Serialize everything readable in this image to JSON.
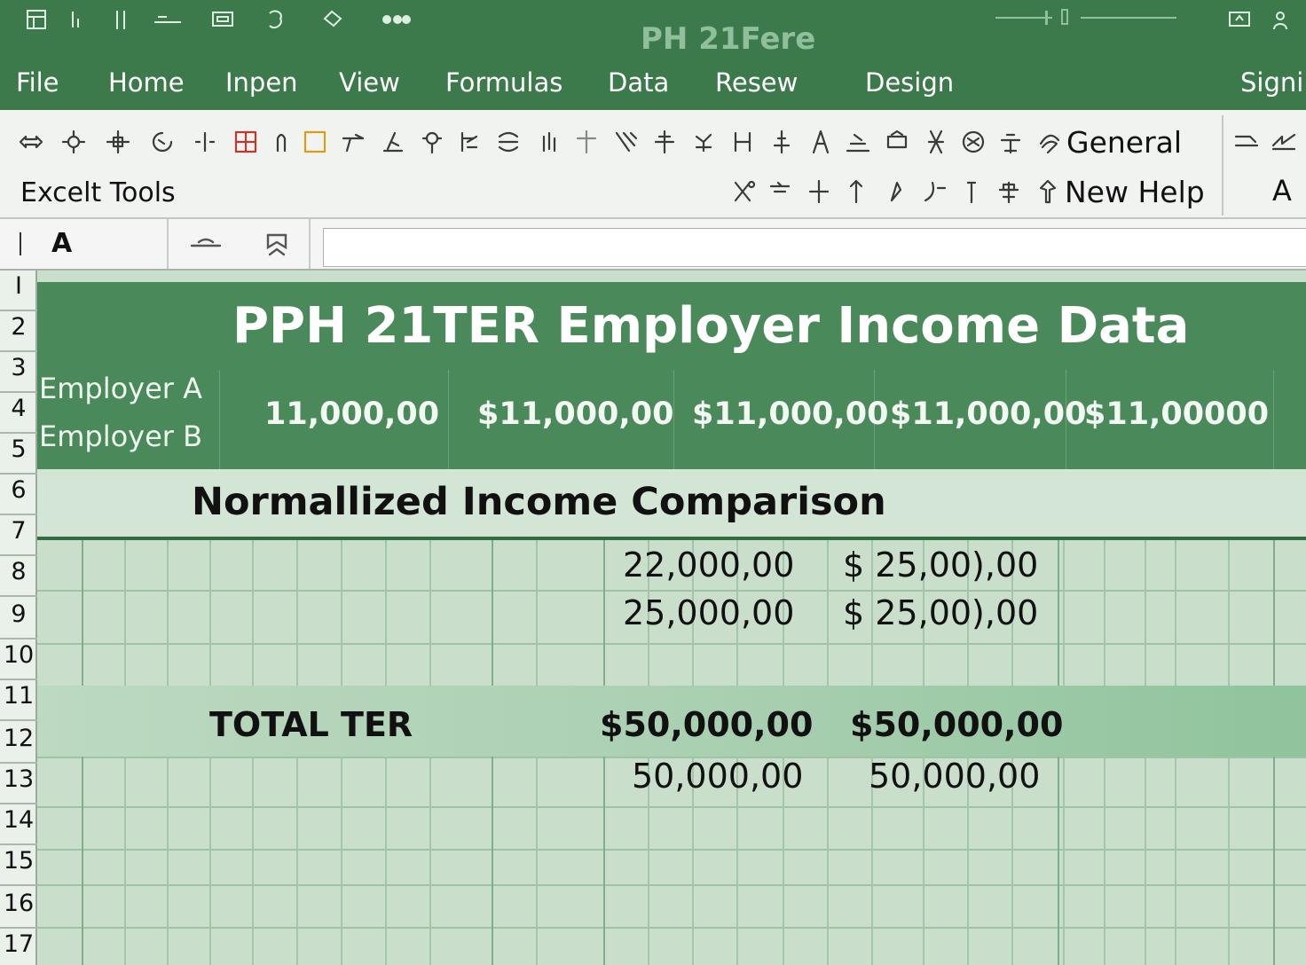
{
  "app": {
    "title": "PH 21Fere",
    "tabs": [
      "File",
      "Home",
      "Inpen",
      "View",
      "Formulas",
      "Data",
      "Resew",
      "Design",
      "Signi"
    ]
  },
  "ribbon": {
    "tools_label": "Excelt Tools",
    "number_format": "General",
    "help_label": "New Help",
    "font_button": "A"
  },
  "formula_bar": {
    "name_box": "A",
    "formula": ""
  },
  "sheet": {
    "row_numbers": [
      "I",
      "2",
      "3",
      "4",
      "5",
      "6",
      "7",
      "8",
      "9",
      "10",
      "11",
      "12",
      "13",
      "14",
      "15",
      "16",
      "17"
    ],
    "title": "PPH 21TER Employer Income Data",
    "employers": [
      "Employer A",
      "Employer B"
    ],
    "employer_values": [
      "11,000,00",
      "$11,000,00",
      "$11,000,00",
      "$11,000,00",
      "$11,00000"
    ],
    "section_title": "Normallized Income Comparison",
    "rows": [
      {
        "left": "22,000,00",
        "right": "$ 25,00),00"
      },
      {
        "left": "25,000,00",
        "right": "$ 25,00),00"
      }
    ],
    "total_label": "TOTAL TER",
    "total_values": [
      "$50,000,00",
      "$50,000,00"
    ],
    "total_sub_values": [
      "50,000,00",
      "50,000,00"
    ]
  },
  "colors": {
    "header_green": "#3c7a4c",
    "band_green": "#4a8a5a",
    "grid_bg": "#c9dfcb"
  }
}
